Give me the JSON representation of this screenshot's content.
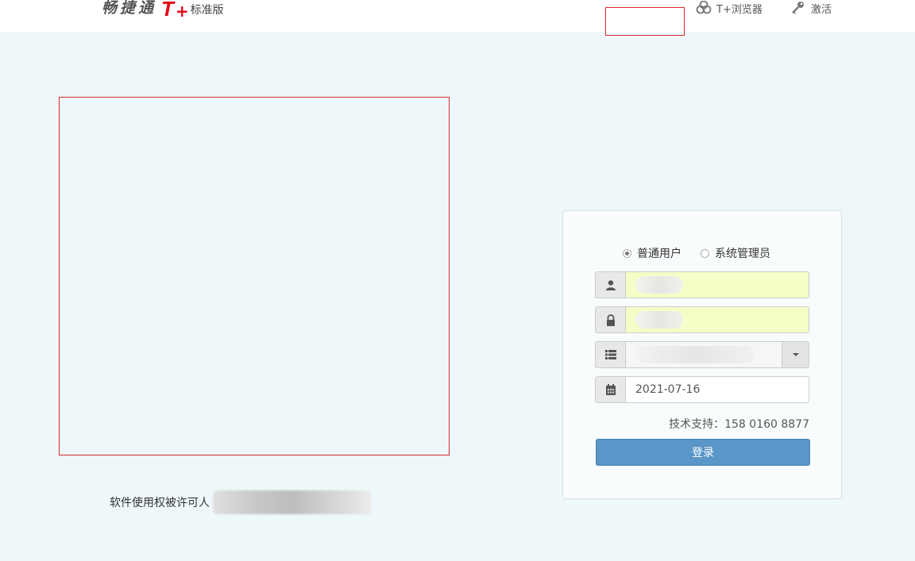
{
  "header": {
    "logo_text": "畅捷通",
    "logo_product": "T",
    "logo_plus": "+",
    "edition": "标准版",
    "links": [
      {
        "label": "T+浏览器",
        "icon": "cloud-icon"
      },
      {
        "label": "激活",
        "icon": "key-icon"
      }
    ]
  },
  "license": {
    "label": "软件使用权被许可人"
  },
  "login": {
    "roles": [
      {
        "label": "普通用户",
        "checked": true
      },
      {
        "label": "系统管理员",
        "checked": false
      }
    ],
    "username_icon": "user-icon",
    "password_icon": "lock-icon",
    "account_icon": "list-icon",
    "date_icon": "calendar-icon",
    "date_value": "2021-07-16",
    "support_text": "技术支持：158 0160 8877",
    "login_label": "登录"
  },
  "colors": {
    "brand_red": "#e50012",
    "login_button": "#5a96c7",
    "autofill_yellow": "#f6fdc7",
    "background": "#eef8fa"
  }
}
